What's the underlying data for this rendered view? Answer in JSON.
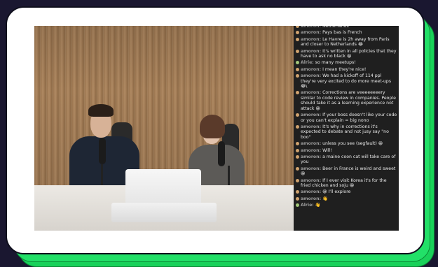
{
  "colors": {
    "background": "#1a1730",
    "card": "#ffffff",
    "stack_green": "#22e068",
    "chat_bg": "#1f1f1f",
    "chat_text": "#e9e9e9",
    "username": "#9a9a9a"
  },
  "video": {
    "scene": "two-people-podcast"
  },
  "chat": {
    "messages": [
      {
        "user": "amoron",
        "text": "Netherlands",
        "avatar": "user-avatar-icon"
      },
      {
        "user": "amoron",
        "text": "Pays bas is French",
        "avatar": "user-avatar-icon"
      },
      {
        "user": "amoron",
        "text": "Le Havre is 2h away from Paris and closer to Netherlands 😂",
        "avatar": "user-avatar-icon"
      },
      {
        "user": "amoron",
        "text": "It's written in all policies that they have to ask no black 😀",
        "avatar": "user-avatar-icon"
      },
      {
        "user": "Alrie",
        "text": "so many meetups!",
        "avatar": "user-avatar-icon-alt"
      },
      {
        "user": "amoron",
        "text": "I mean they're nice!",
        "avatar": "user-avatar-icon"
      },
      {
        "user": "amoron",
        "text": "We had a kickoff of 114 ppl they're very excited to do more meet-ups 😂\\",
        "avatar": "user-avatar-icon"
      },
      {
        "user": "amoron",
        "text": "Corrections are veeeeeeeery similar to code review in companies. People should take it as a learning experience not attack 😀",
        "avatar": "user-avatar-icon"
      },
      {
        "user": "amoron",
        "text": "If your boss doesn't like your code or you can't explain = big nono",
        "avatar": "user-avatar-icon"
      },
      {
        "user": "amoron",
        "text": "It's why in corrections it's expected to debate and not jusy say \"no boo\"",
        "avatar": "user-avatar-icon"
      },
      {
        "user": "amoron",
        "text": "unless you see (segfault) 😀",
        "avatar": "user-avatar-icon"
      },
      {
        "user": "amoron",
        "text": "Will!",
        "avatar": "user-avatar-icon"
      },
      {
        "user": "amoron",
        "text": "a maine coon cat will take care of you",
        "avatar": "user-avatar-icon"
      },
      {
        "user": "amoron",
        "text": "Beer in France is weird and sweet 😀",
        "avatar": "user-avatar-icon"
      },
      {
        "user": "amoron",
        "text": "If I ever visit Korea it's for the fried chicken and soju 😀",
        "avatar": "user-avatar-icon"
      },
      {
        "user": "amoron",
        "text": "😀 I'll explore",
        "avatar": "user-avatar-icon"
      },
      {
        "user": "amoron",
        "text": "👋",
        "avatar": "user-avatar-icon"
      },
      {
        "user": "Alrie",
        "text": "👋",
        "avatar": "user-avatar-icon-alt"
      }
    ]
  }
}
